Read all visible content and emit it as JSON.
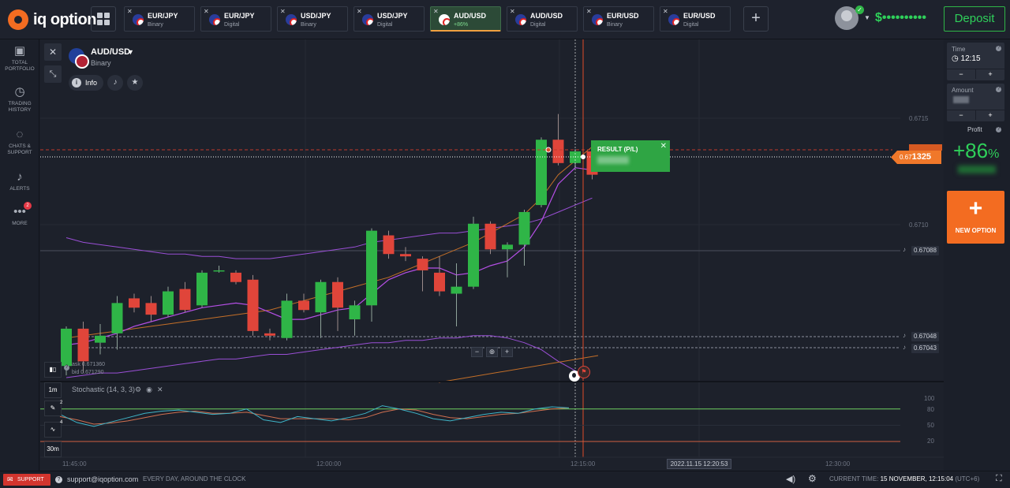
{
  "brand": {
    "logo_text": "iq option"
  },
  "tabs": [
    {
      "name": "EUR/JPY",
      "sub": "Binary"
    },
    {
      "name": "EUR/JPY",
      "sub": "Digital"
    },
    {
      "name": "USD/JPY",
      "sub": "Binary"
    },
    {
      "name": "USD/JPY",
      "sub": "Digital"
    },
    {
      "name": "AUD/USD",
      "sub": "+86%"
    },
    {
      "name": "AUD/USD",
      "sub": "Digital"
    },
    {
      "name": "EUR/USD",
      "sub": "Binary"
    },
    {
      "name": "EUR/USD",
      "sub": "Digital"
    }
  ],
  "header": {
    "add_tab": "+",
    "balance": "$••••••••••",
    "deposit": "Deposit"
  },
  "sidebar": [
    {
      "icon": "portfolio-icon",
      "label": "TOTAL PORTFOLIO"
    },
    {
      "icon": "history-icon",
      "label": "TRADING HISTORY"
    },
    {
      "icon": "chat-icon",
      "label": "CHATS & SUPPORT"
    },
    {
      "icon": "bell-icon",
      "label": "ALERTS"
    },
    {
      "icon": "more-icon",
      "label": "MORE",
      "badge": "2"
    }
  ],
  "asset": {
    "name": "AUD/USD",
    "type": "Binary",
    "info_label": "Info"
  },
  "price_axis": {
    "ticks": [
      "0.6715",
      "0.6710"
    ],
    "current_small": "0.67",
    "current_big": "1325",
    "alerts": [
      "0.67088",
      "0.67048",
      "0.67043"
    ]
  },
  "result": {
    "title": "RESULT (P/L)"
  },
  "chart_info": {
    "ask": "ask 0.671360",
    "bid": "bid 0.671290"
  },
  "indicator_buttons": [
    {
      "label": "1m"
    },
    {
      "label": "",
      "count": "2",
      "icon": "pencil-icon"
    },
    {
      "label": "",
      "count": "4",
      "icon": "wave-icon"
    },
    {
      "label": "30m"
    }
  ],
  "stochastic": {
    "label": "Stochastic (14, 3, 3)",
    "levels": [
      "100",
      "80",
      "50",
      "20"
    ]
  },
  "time_axis": {
    "labels": [
      "11:45:00",
      "12:00:00",
      "12:15:00",
      "12:30:00"
    ],
    "cursor_date": "2022.11.15 12:20:53"
  },
  "right_panel": {
    "time_label": "Time",
    "time_value": "12:15",
    "amount_label": "Amount",
    "profit_label": "Profit",
    "profit_value": "+86",
    "profit_unit": "%",
    "new_option": "NEW OPTION"
  },
  "footer": {
    "support": "SUPPORT",
    "email": "support@iqoption.com",
    "tagline": "EVERY DAY, AROUND THE CLOCK",
    "current_time_label": "CURRENT TIME:",
    "current_time_value": "15 NOVEMBER, 12:15:04",
    "timezone": "(UTC+6)"
  },
  "chart_data": {
    "type": "candlestick",
    "y_range": [
      0.67037,
      0.67183
    ],
    "candles": [
      {
        "o": 0.67043,
        "h": 0.6706,
        "l": 0.67039,
        "c": 0.67059
      },
      {
        "o": 0.67059,
        "h": 0.67062,
        "l": 0.6704,
        "c": 0.67045
      },
      {
        "o": 0.67053,
        "h": 0.67061,
        "l": 0.67048,
        "c": 0.67056
      },
      {
        "o": 0.67057,
        "h": 0.67073,
        "l": 0.6705,
        "c": 0.6707
      },
      {
        "o": 0.67072,
        "h": 0.67074,
        "l": 0.67066,
        "c": 0.67068
      },
      {
        "o": 0.6707,
        "h": 0.67073,
        "l": 0.67062,
        "c": 0.67065
      },
      {
        "o": 0.67065,
        "h": 0.67077,
        "l": 0.67064,
        "c": 0.67075
      },
      {
        "o": 0.67076,
        "h": 0.67079,
        "l": 0.67066,
        "c": 0.67067
      },
      {
        "o": 0.67069,
        "h": 0.67084,
        "l": 0.67068,
        "c": 0.67083
      },
      {
        "o": 0.67084,
        "h": 0.67086,
        "l": 0.67083,
        "c": 0.67084
      },
      {
        "o": 0.67083,
        "h": 0.67084,
        "l": 0.67078,
        "c": 0.67079
      },
      {
        "o": 0.6708,
        "h": 0.67082,
        "l": 0.67056,
        "c": 0.67058
      },
      {
        "o": 0.67057,
        "h": 0.67059,
        "l": 0.67054,
        "c": 0.67056
      },
      {
        "o": 0.67055,
        "h": 0.67074,
        "l": 0.67054,
        "c": 0.67071
      },
      {
        "o": 0.67071,
        "h": 0.67074,
        "l": 0.67066,
        "c": 0.67067
      },
      {
        "o": 0.67066,
        "h": 0.6708,
        "l": 0.67055,
        "c": 0.67079
      },
      {
        "o": 0.67079,
        "h": 0.67081,
        "l": 0.67058,
        "c": 0.67068
      },
      {
        "o": 0.67063,
        "h": 0.67071,
        "l": 0.67056,
        "c": 0.67069
      },
      {
        "o": 0.67069,
        "h": 0.67102,
        "l": 0.67062,
        "c": 0.67101
      },
      {
        "o": 0.67099,
        "h": 0.67101,
        "l": 0.67089,
        "c": 0.67091
      },
      {
        "o": 0.67091,
        "h": 0.67094,
        "l": 0.67088,
        "c": 0.6709
      },
      {
        "o": 0.67089,
        "h": 0.6709,
        "l": 0.67075,
        "c": 0.67084
      },
      {
        "o": 0.67083,
        "h": 0.6709,
        "l": 0.67073,
        "c": 0.67075
      },
      {
        "o": 0.67074,
        "h": 0.67087,
        "l": 0.6706,
        "c": 0.67077
      },
      {
        "o": 0.67077,
        "h": 0.67107,
        "l": 0.67076,
        "c": 0.67104
      },
      {
        "o": 0.67104,
        "h": 0.67105,
        "l": 0.67091,
        "c": 0.67093
      },
      {
        "o": 0.67093,
        "h": 0.67096,
        "l": 0.67081,
        "c": 0.67095
      },
      {
        "o": 0.67095,
        "h": 0.6711,
        "l": 0.67086,
        "c": 0.67109
      },
      {
        "o": 0.67112,
        "h": 0.67141,
        "l": 0.67111,
        "c": 0.6714
      },
      {
        "o": 0.6714,
        "h": 0.67151,
        "l": 0.67129,
        "c": 0.6713
      },
      {
        "o": 0.6713,
        "h": 0.67136,
        "l": 0.67128,
        "c": 0.67135
      },
      {
        "o": 0.67135,
        "h": 0.67138,
        "l": 0.67123,
        "c": 0.67125
      }
    ],
    "bollinger_upper": [
      0.67055,
      0.67056,
      0.67057,
      0.67058,
      0.67059,
      0.6706,
      0.67061,
      0.67062,
      0.67063,
      0.67064,
      0.67065,
      0.67066,
      0.67067,
      0.67069,
      0.67071,
      0.67073,
      0.67075,
      0.67077,
      0.67079,
      0.67081,
      0.67084,
      0.67087,
      0.6709,
      0.67093,
      0.67096,
      0.671,
      0.67104,
      0.67108,
      0.67115,
      0.67125,
      0.67131,
      0.67137
    ],
    "bollinger_lower": [
      0.67038,
      0.67039,
      0.6704,
      0.6704,
      0.67041,
      0.67042,
      0.67043,
      0.67044,
      0.67045,
      0.67046,
      0.67046,
      0.67047,
      0.67048,
      0.67048,
      0.67049,
      0.6705,
      0.67051,
      0.67052,
      0.67053,
      0.67053,
      0.67054,
      0.67054,
      0.67055,
      0.67055,
      0.67056,
      0.67056,
      0.67055,
      0.67053,
      0.6705,
      0.67045,
      0.67041
    ],
    "ma_line": [
      0.67052,
      0.67053,
      0.67055,
      0.67057,
      0.6706,
      0.67062,
      0.67064,
      0.67066,
      0.67068,
      0.67069,
      0.6707,
      0.67069,
      0.67066,
      0.67063,
      0.67063,
      0.67065,
      0.67067,
      0.67068,
      0.67074,
      0.6708,
      0.67083,
      0.67085,
      0.67085,
      0.67082,
      0.67083,
      0.67086,
      0.67088,
      0.67094,
      0.67105,
      0.67121,
      0.67128,
      0.67127
    ],
    "envelope_upper": [
      0.67098,
      0.67096,
      0.67095,
      0.67094,
      0.67093,
      0.67092,
      0.67091,
      0.67091,
      0.6709,
      0.6709,
      0.67089,
      0.67089,
      0.67089,
      0.6709,
      0.67091,
      0.67092,
      0.67093,
      0.67094,
      0.67096,
      0.67097,
      0.67098,
      0.67099,
      0.671,
      0.671,
      0.67101,
      0.67102,
      0.67103,
      0.67104,
      0.67106,
      0.67109,
      0.67112,
      0.67115
    ],
    "stoch_k": [
      70,
      55,
      48,
      56,
      64,
      72,
      76,
      78,
      74,
      70,
      72,
      80,
      60,
      55,
      66,
      62,
      58,
      64,
      72,
      86,
      80,
      72,
      62,
      58,
      64,
      70,
      74,
      72,
      80,
      84,
      82
    ],
    "stoch_d": [
      66,
      60,
      52,
      54,
      58,
      64,
      70,
      74,
      76,
      72,
      72,
      74,
      68,
      62,
      62,
      62,
      62,
      60,
      64,
      74,
      80,
      78,
      70,
      64,
      62,
      66,
      70,
      72,
      76,
      80,
      82
    ]
  }
}
